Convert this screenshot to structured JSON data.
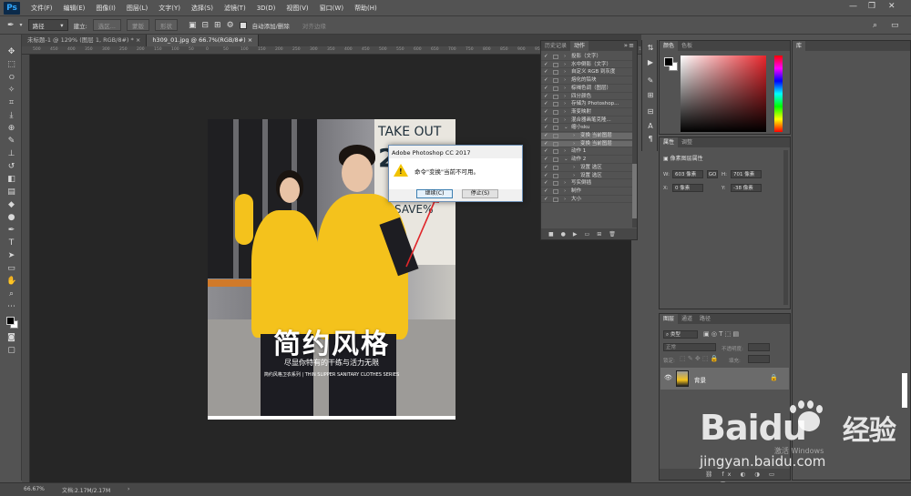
{
  "app": {
    "logo": "Ps"
  },
  "menu": [
    "文件(F)",
    "编辑(E)",
    "图像(I)",
    "图层(L)",
    "文字(Y)",
    "选择(S)",
    "滤镜(T)",
    "3D(D)",
    "视图(V)",
    "窗口(W)",
    "帮助(H)"
  ],
  "options": {
    "path_mode": "路径",
    "btn_build": "建立:",
    "btn_select": "选区...",
    "btn_mask": "蒙版",
    "btn_shape": "形状",
    "auto_add_delete": "自动添加/删除",
    "align_edges": "对齐边缘"
  },
  "tabs": [
    {
      "label": "未标题-1 @ 129% (图层 1, RGB/8#) *",
      "close": "×"
    },
    {
      "label": "h309_01.jpg @ 66.7%(RGB/8#)",
      "close": "×"
    }
  ],
  "ruler_ticks": [
    "500",
    "450",
    "400",
    "350",
    "300",
    "250",
    "200",
    "150",
    "100",
    "50",
    "0",
    "50",
    "100",
    "150",
    "200",
    "250",
    "300",
    "350",
    "400",
    "450",
    "500",
    "550",
    "600",
    "650",
    "700",
    "750",
    "800",
    "850",
    "900",
    "950",
    "1000",
    "1050",
    "1100",
    "1150",
    "1200",
    "1250"
  ],
  "document": {
    "sign_top": "TAKE OUT",
    "sign_mid": "2",
    "sign_bottom": "ITY SAVE%",
    "title": "简约风格",
    "subtitle": "尽显你特有的干练与活力无限",
    "tagline": "简约风格卫衣系列 | THIN SLIPPER SANITARY CLOTHES SERIES"
  },
  "dialog": {
    "title": "Adobe Photoshop CC 2017",
    "message": "命令\"变换\"当前不可用。",
    "continue": "继续(C)",
    "stop": "停止(S)"
  },
  "actions_panel": {
    "tab_history": "历史记录",
    "tab_actions": "动作",
    "rows": [
      {
        "indent": 0,
        "arrow": "›",
        "label": "投影（文字）"
      },
      {
        "indent": 0,
        "arrow": "›",
        "label": "水中倒影（文字）"
      },
      {
        "indent": 0,
        "arrow": "›",
        "label": "自定义 RGB 到灰度"
      },
      {
        "indent": 0,
        "arrow": "›",
        "label": "熔化的铅块"
      },
      {
        "indent": 0,
        "arrow": "›",
        "label": "棕褐色调（图层）"
      },
      {
        "indent": 0,
        "arrow": "›",
        "label": "四分颜色"
      },
      {
        "indent": 0,
        "arrow": "›",
        "label": "存储为 Photoshop..."
      },
      {
        "indent": 0,
        "arrow": "›",
        "label": "渐变映射"
      },
      {
        "indent": 0,
        "arrow": "›",
        "label": "混合器画笔克隆..."
      },
      {
        "indent": 0,
        "arrow": "⌄",
        "label": "缩小sku"
      },
      {
        "indent": 1,
        "arrow": "›",
        "label": "变换 当前图层"
      },
      {
        "indent": 1,
        "arrow": "›",
        "label": "变换 当前图层"
      },
      {
        "indent": 0,
        "arrow": "›",
        "label": "动作 1"
      },
      {
        "indent": 0,
        "arrow": "⌄",
        "label": "动作 2"
      },
      {
        "indent": 1,
        "arrow": "›",
        "label": "设置 选区"
      },
      {
        "indent": 1,
        "arrow": "›",
        "label": "设置 选区"
      },
      {
        "indent": 0,
        "arrow": "›",
        "label": "写实倒插"
      },
      {
        "indent": 0,
        "arrow": "›",
        "label": "制作"
      },
      {
        "indent": 0,
        "arrow": "›",
        "label": "大小"
      }
    ]
  },
  "color_panel": {
    "tab_color": "颜色",
    "tab_swatches": "色板"
  },
  "props_panel": {
    "tab_props": "属性",
    "tab_adjust": "调整",
    "section": "像素图层属性",
    "w_label": "W:",
    "w_value": "603 像素",
    "h_label": "H:",
    "h_value": "701 像素",
    "x_label": "X:",
    "x_value": "0 像素",
    "y_label": "Y:",
    "y_value": "-38 像素",
    "link": "GO"
  },
  "layers_panel": {
    "tab_layers": "图层",
    "tab_channels": "通道",
    "tab_paths": "路径",
    "kind": "类型",
    "blend": "正常",
    "opacity_label": "不透明度:",
    "lock_label": "锁定:",
    "fill_label": "填充:",
    "layer_name": "背景"
  },
  "library_panel": {
    "tab": "库"
  },
  "status": {
    "zoom": "66.67%",
    "doc": "文档:2.17M/2.17M"
  },
  "watermark": {
    "brand": "Baidu",
    "jing": "经验",
    "url": "jingyan.baidu.com",
    "windows": "激活 Windows"
  }
}
